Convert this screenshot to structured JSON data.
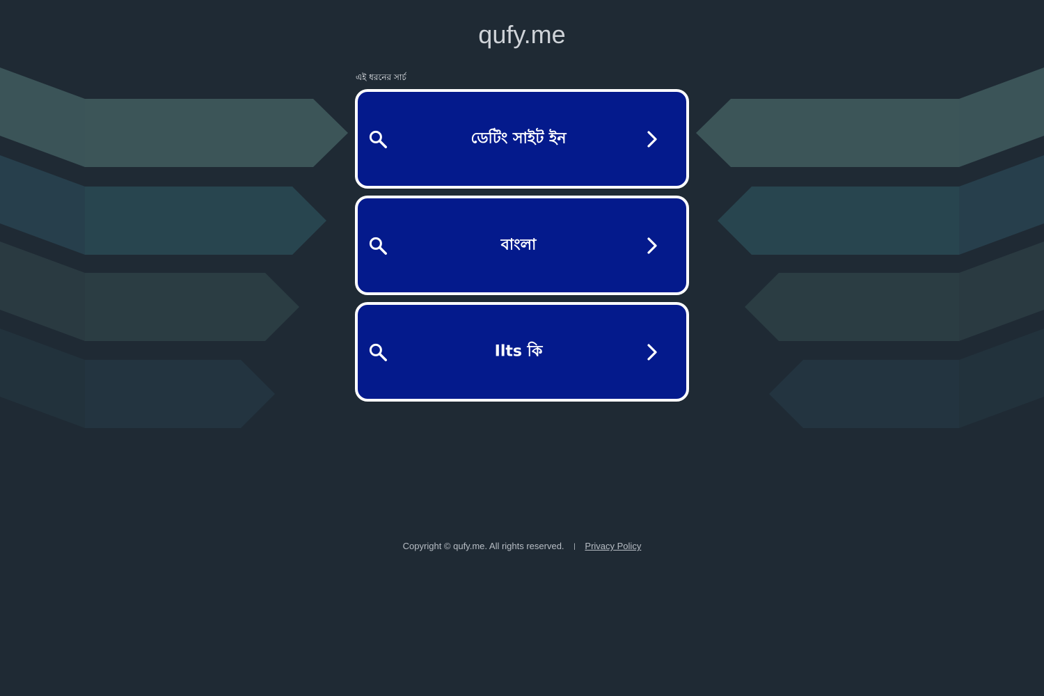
{
  "header": {
    "domain": "qufy.me"
  },
  "search": {
    "label": "এই ধরনের সার্চ"
  },
  "results": [
    {
      "label": "ডেটিং সাইট ইন",
      "icon": "search-icon",
      "arrow": "chevron-right-icon"
    },
    {
      "label": "বাংলা",
      "icon": "search-icon",
      "arrow": "chevron-right-icon"
    },
    {
      "label": "Ilts কি",
      "icon": "search-icon",
      "arrow": "chevron-right-icon"
    }
  ],
  "footer": {
    "copyright": "Copyright © qufy.me.  All rights reserved.",
    "separator": "|",
    "privacy": "Privacy Policy"
  },
  "colors": {
    "background": "#1f2a34",
    "button": "#041a8c",
    "button_border": "#ffffff"
  }
}
